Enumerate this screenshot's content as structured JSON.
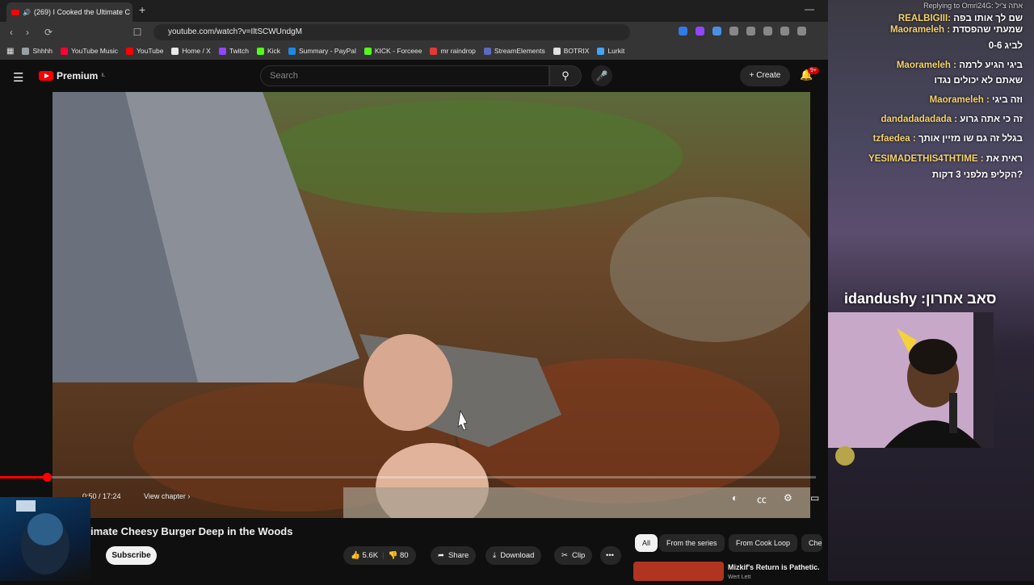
{
  "browser": {
    "tab_title": "(269) I Cooked the Ultimate C",
    "url": "youtube.com/watch?v=IltSCWUndgM",
    "bookmarks": [
      {
        "label": "Shhhh",
        "color": "#9aa0a6"
      },
      {
        "label": "YouTube Music",
        "color": "#ff0033"
      },
      {
        "label": "YouTube",
        "color": "#ff0000"
      },
      {
        "label": "Home / X",
        "color": "#e7e9ea"
      },
      {
        "label": "Twitch",
        "color": "#9146ff"
      },
      {
        "label": "Kick",
        "color": "#53fc18"
      },
      {
        "label": "Summary - PayPal",
        "color": "#1e88e5"
      },
      {
        "label": "KICK - Forceee",
        "color": "#53fc18"
      },
      {
        "label": "mr raindrop",
        "color": "#e53935"
      },
      {
        "label": "StreamElements",
        "color": "#5c6bc0"
      },
      {
        "label": "BOTRIX",
        "color": "#e0e0e0"
      },
      {
        "label": "Lurkit",
        "color": "#42a5f5"
      }
    ]
  },
  "youtube": {
    "logo_text": "Premium",
    "logo_region": "IL",
    "search_placeholder": "Search",
    "create_label": "Create",
    "notif_count": "9+"
  },
  "player": {
    "time": "0:50 / 17:24",
    "view_chapter": "View chapter",
    "progress": 0.057
  },
  "video": {
    "title": "imate Cheesy Burger Deep in the Woods",
    "subscribe": "Subscribe",
    "likes": "5.6K",
    "dislikes": "80",
    "share": "Share",
    "download": "Download",
    "clip": "Clip"
  },
  "chips": [
    "All",
    "From the series",
    "From Cook Loop",
    "Che"
  ],
  "rec": {
    "title": "Mizkif's Return is Pathetic.",
    "channel": "Wert Lett"
  },
  "chat": {
    "reply_header": "Replying to Omri24G: אתה צ'יל",
    "lines": [
      {
        "user": "REALBIGIII:",
        "text": "שם לך אותו בפה"
      },
      {
        "user": "Maorameleh :",
        "text": "שמעתי שהפסדת"
      },
      {
        "user": "",
        "text": "לביג 0-6"
      },
      {
        "user": "Maorameleh :",
        "text": "ביגי הגיע לרמה"
      },
      {
        "user": "",
        "text": "שאתם לא יכולים נגדו"
      },
      {
        "user": "Maorameleh :",
        "text": "וזה ביגי"
      },
      {
        "user": "dandadadadada :",
        "text": "זה כי אתה גרוע"
      },
      {
        "user": "tzfaedea :",
        "text": "בגלל זה גם שו מזיין אותך"
      },
      {
        "user": "YESIMADETHIS4THTIME :",
        "text": "ראית את"
      },
      {
        "user": "",
        "text": "הקליפ מלפני 3 דקות?"
      }
    ]
  },
  "overlay_text": "idandushy :סאב אחרון"
}
